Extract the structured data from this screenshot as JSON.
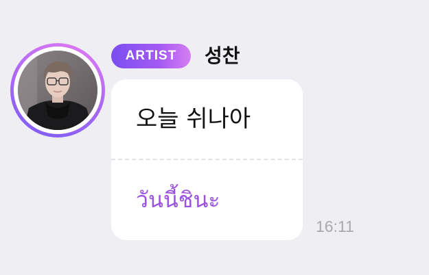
{
  "message": {
    "badge_label": "ARTIST",
    "sender_name": "성찬",
    "text": "오늘 쉬나아",
    "translation": "วันนี้ชินะ",
    "time": "16:11"
  },
  "colors": {
    "background": "#efeef3",
    "badge_gradient_start": "#7b4df0",
    "badge_gradient_end": "#d57ef2",
    "translation_text": "#9b52e0",
    "timestamp_text": "#a9a8ae"
  },
  "icons": {
    "avatar": "user-profile-photo"
  }
}
